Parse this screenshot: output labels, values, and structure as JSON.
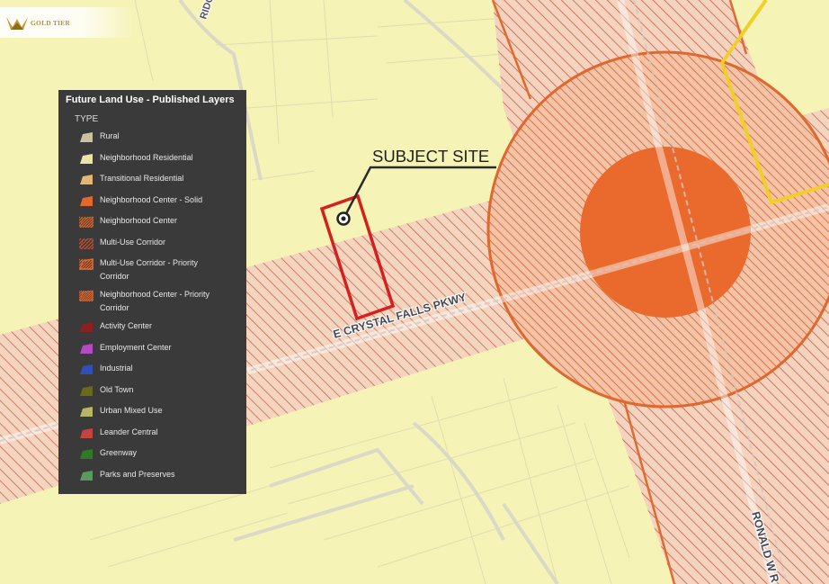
{
  "logo": {
    "text": "GOLD TIER",
    "color": "#b8902f"
  },
  "map": {
    "subject_label": "SUBJECT SITE",
    "roads": {
      "crystal_falls": "E CRYSTAL FALLS PKWY",
      "ronald": "RONALD W R",
      "ridge": "RIDG"
    }
  },
  "legend": {
    "title": "Future Land Use - Published Layers",
    "subheading": "TYPE",
    "items": [
      {
        "label": "Rural",
        "color": "#c9c1a0",
        "style": "solid"
      },
      {
        "label": "Neighborhood Residential",
        "color": "#ece3a9",
        "style": "solid"
      },
      {
        "label": "Transitional Residential",
        "color": "#e2b678",
        "style": "solid"
      },
      {
        "label": "Neighborhood Center - Solid",
        "color": "#e36a2e",
        "style": "solid"
      },
      {
        "label": "Neighborhood Center",
        "color": "#e36a2e",
        "style": "hatch"
      },
      {
        "label": "Multi-Use Corridor",
        "color": "#c8563e",
        "style": "hatch-light"
      },
      {
        "label": "Multi-Use Corridor - Priority Corridor",
        "color": "#e36a2e",
        "style": "priority"
      },
      {
        "label": "Neighborhood Center - Priority Corridor",
        "color": "#e36a2e",
        "style": "hatch-dense"
      },
      {
        "label": "Activity Center",
        "color": "#8a2121",
        "style": "solid"
      },
      {
        "label": "Employment Center",
        "color": "#b34cc4",
        "style": "solid"
      },
      {
        "label": "Industrial",
        "color": "#3050b8",
        "style": "solid"
      },
      {
        "label": "Old Town",
        "color": "#6b6a1a",
        "style": "solid"
      },
      {
        "label": "Urban Mixed Use",
        "color": "#b7b56a",
        "style": "solid"
      },
      {
        "label": "Leander Central",
        "color": "#c44444",
        "style": "solid"
      },
      {
        "label": "Greenway",
        "color": "#2f7a25",
        "style": "solid"
      },
      {
        "label": "Parks and Preserves",
        "color": "#5a9a5e",
        "style": "solid"
      }
    ]
  }
}
